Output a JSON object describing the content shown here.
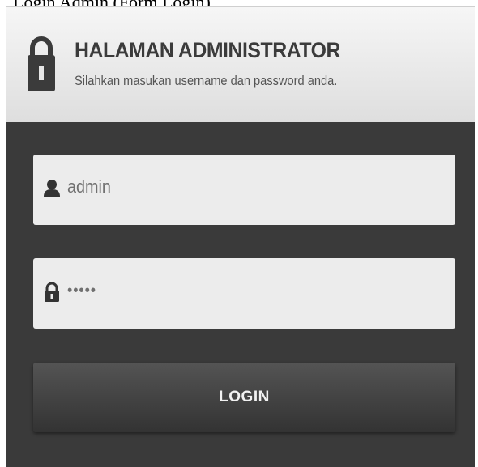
{
  "caption": "Login Admin (Form Login)",
  "header": {
    "icon": "lock-icon",
    "title": "HALAMAN ADMINISTRATOR",
    "subtitle": "Silahkan masukan username dan password anda."
  },
  "username": {
    "icon": "user-icon",
    "value": "admin"
  },
  "password": {
    "icon": "lock-icon",
    "value": "•••••"
  },
  "login_button": {
    "label": "LOGIN"
  },
  "colors": {
    "panel": "#3a3a3a",
    "header": "#eaeaea",
    "field": "#ececec",
    "button": "#444444"
  }
}
